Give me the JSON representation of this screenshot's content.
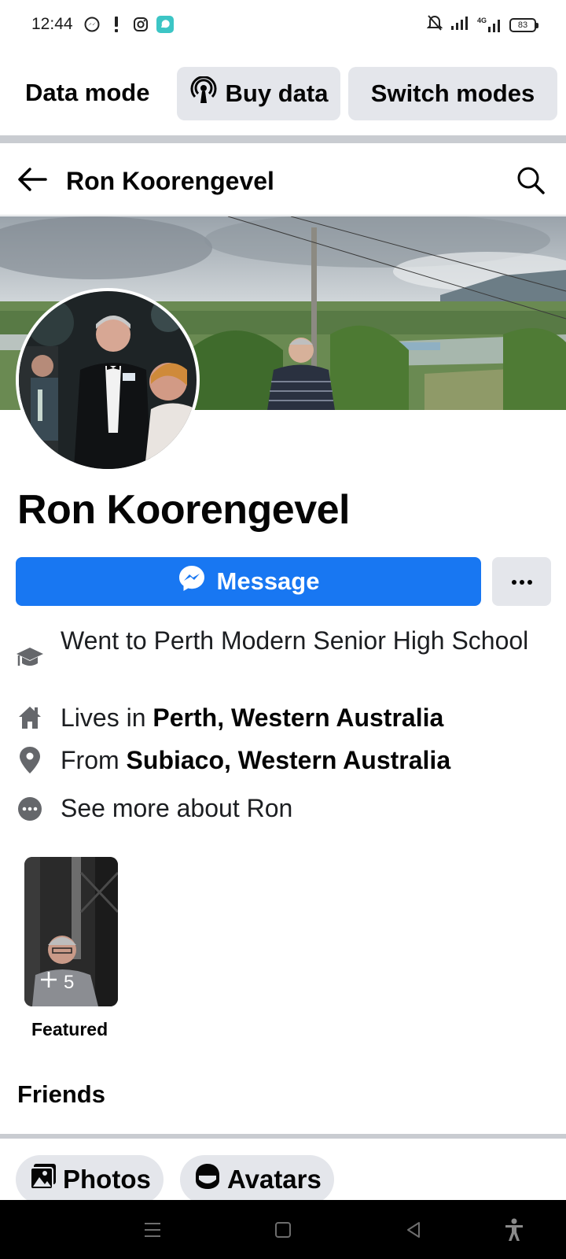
{
  "status_bar": {
    "time": "12:44",
    "battery": "83",
    "network": "4G"
  },
  "data_mode": {
    "title": "Data mode",
    "buy_label": "Buy data",
    "switch_label": "Switch modes"
  },
  "header": {
    "title": "Ron Koorengevel"
  },
  "profile": {
    "name": "Ron Koorengevel",
    "message_label": "Message",
    "more_label": "···"
  },
  "intro": {
    "education_text": "Went to Perth Modern Senior High School",
    "lives_prefix": "Lives in ",
    "lives_place": "Perth, Western Australia",
    "from_prefix": "From ",
    "from_place": "Subiaco, Western Australia",
    "see_more": "See more about Ron"
  },
  "featured": {
    "count": "5",
    "label": "Featured"
  },
  "friends": {
    "title": "Friends"
  },
  "tabs": [
    {
      "label": "Photos"
    },
    {
      "label": "Avatars"
    }
  ],
  "colors": {
    "accent": "#1877f2",
    "button_gray": "#e4e6eb",
    "separator": "#c9ccd1"
  }
}
